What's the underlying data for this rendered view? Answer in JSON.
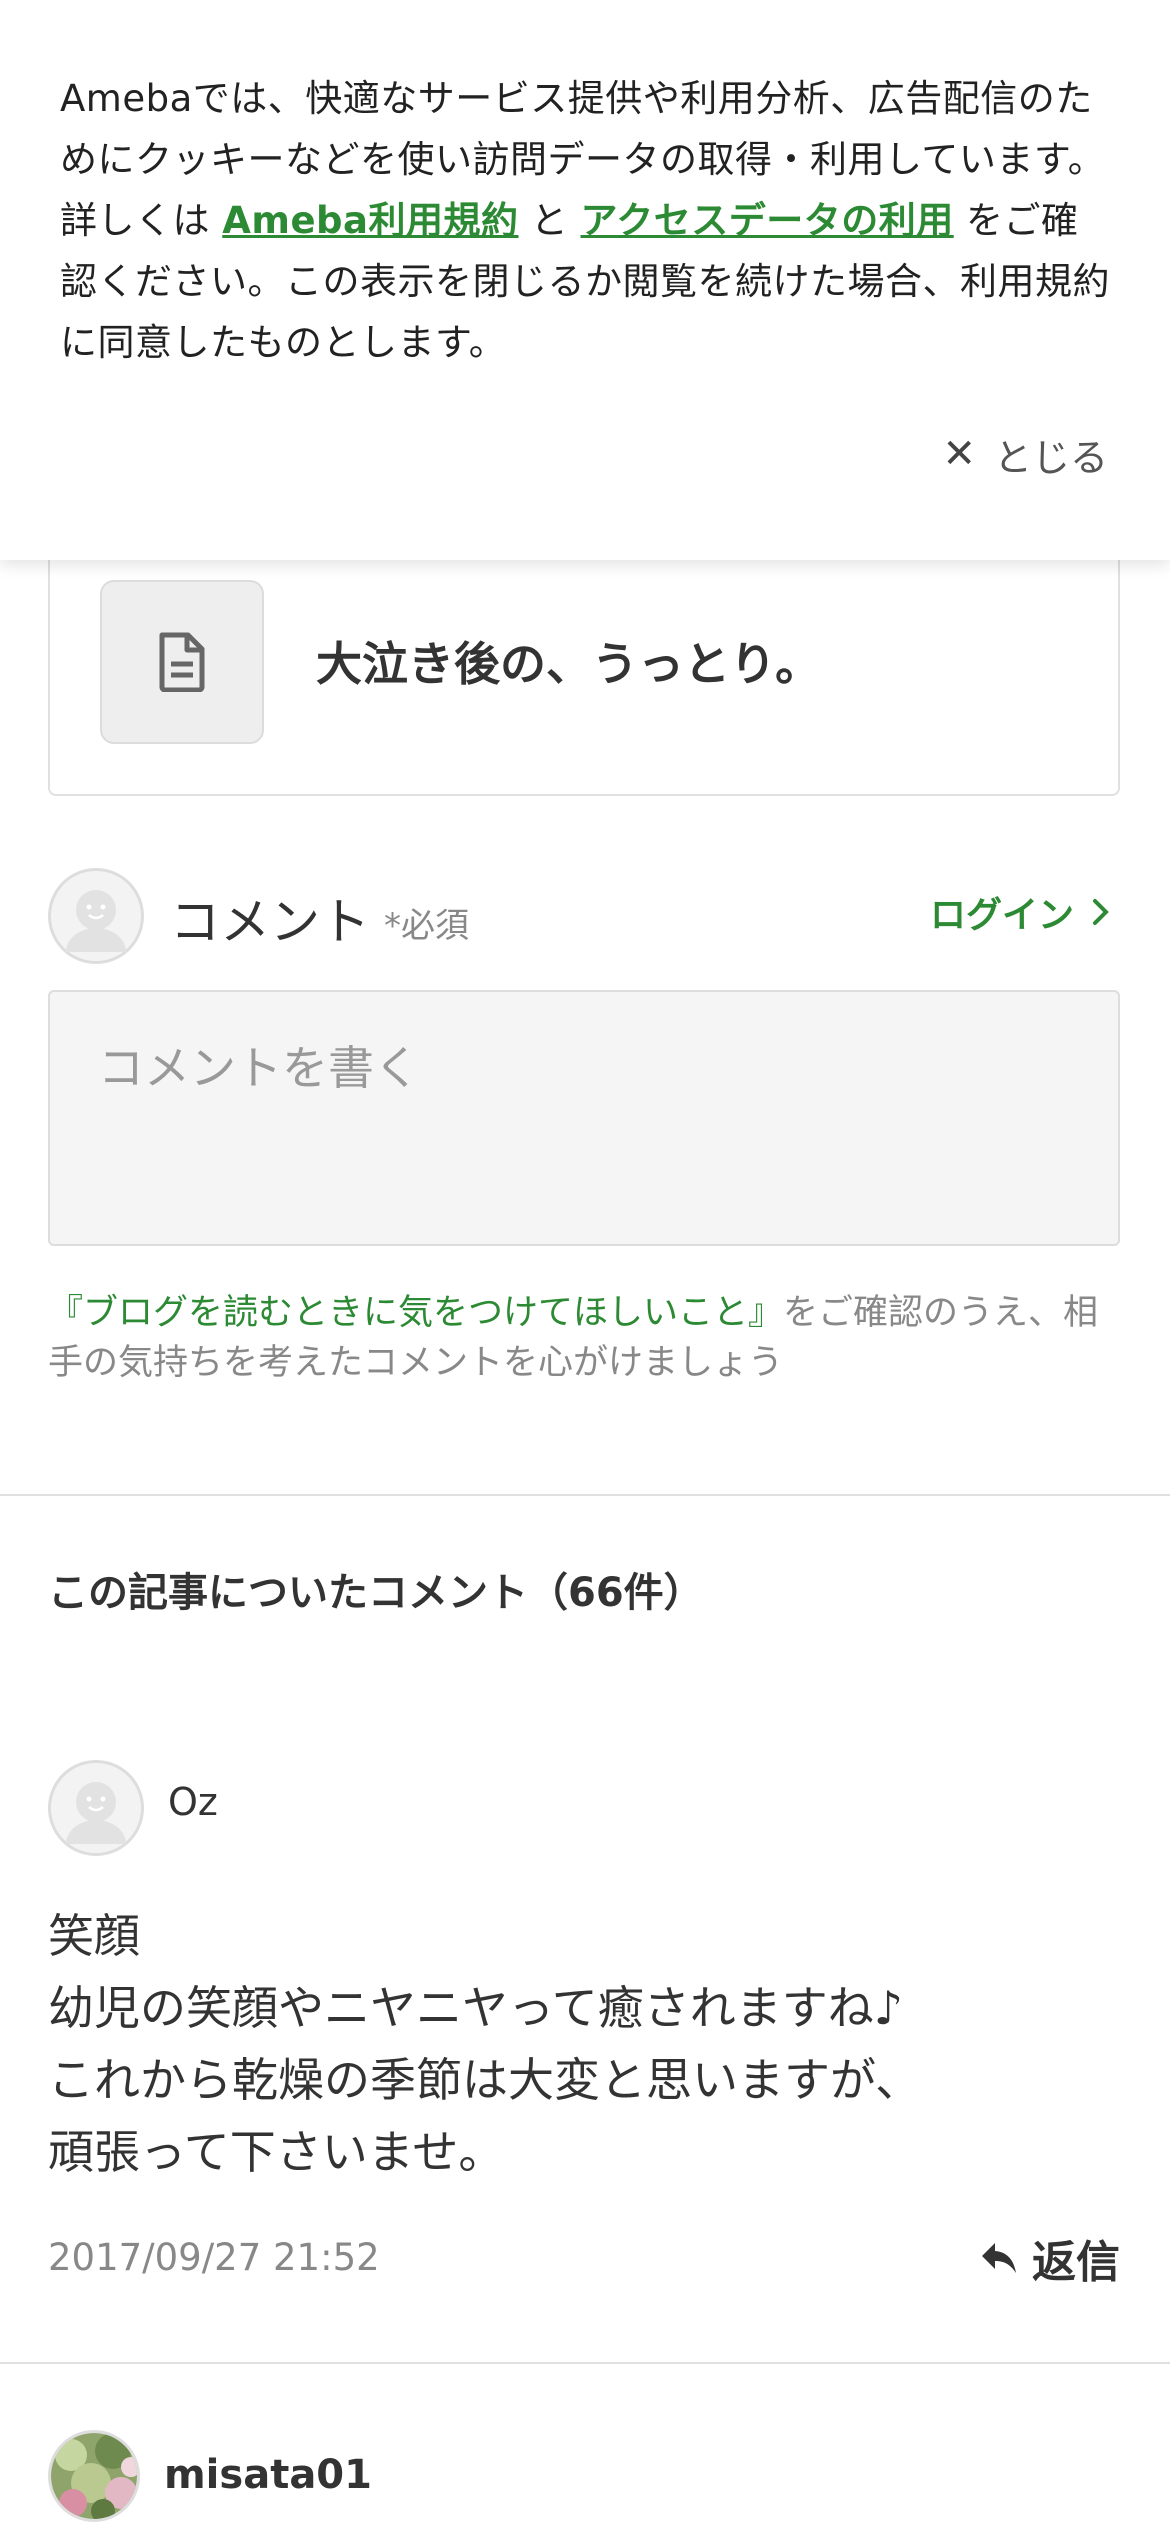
{
  "cookie_banner": {
    "text_intro": "Amebaでは、快適なサービス提供や利用分析、広告配信のためにクッキーなどを使い訪問データの取得・利用しています。詳しくは ",
    "link_terms": "Ameba利用規約",
    "text_and": " と ",
    "link_access_data": "アクセスデータの利用",
    "text_outro": " をご確認ください。この表示を閉じるか閲覧を続けた場合、利用規約に同意したものとします。",
    "close_label": "とじる",
    "close_icon": "✕"
  },
  "related_article": {
    "title": "大泣き後の、うっとり。",
    "icon": "document-icon"
  },
  "comment_form": {
    "heading": "コメント",
    "required": "*必須",
    "login_label": "ログイン",
    "placeholder": "コメントを書く",
    "guideline_link": "『ブログを読むときに気をつけてほしいこと』",
    "guideline_text": "をご確認のうえ、相手の気持ちを考えたコメントを心がけましょう"
  },
  "comments_section": {
    "title": "この記事についたコメント（66件）",
    "items": [
      {
        "author": "Oz",
        "lines": [
          "笑顔",
          "幼児の笑顔やニヤニヤって癒されますね♪",
          "これから乾燥の季節は大変と思いますが、",
          "頑張って下さいませ。"
        ],
        "timestamp": "2017/09/27 21:52",
        "reply_label": "返信"
      },
      {
        "author": "misata01"
      }
    ]
  },
  "colors": {
    "accent_green": "#2d8a34",
    "text_main": "#333333",
    "text_muted": "#888888",
    "divider": "#e0e0e0"
  }
}
